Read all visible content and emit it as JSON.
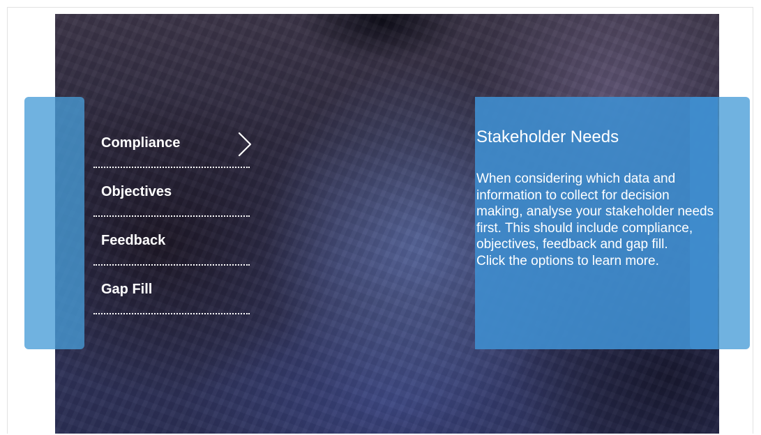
{
  "menu": {
    "items": [
      {
        "label": "Compliance",
        "selected": true
      },
      {
        "label": "Objectives",
        "selected": false
      },
      {
        "label": "Feedback",
        "selected": false
      },
      {
        "label": "Gap Fill",
        "selected": false
      }
    ]
  },
  "panel": {
    "title": "Stakeholder Needs",
    "body": "When considering which data and information to collect for decision making, analyse your stakeholder needs first. This should include compliance, objectives, feedback and gap fill.\nClick the options to learn more."
  },
  "colors": {
    "tab_blue": "#489cd7",
    "panel_blue": "#3f8ccd",
    "text": "#ffffff"
  },
  "icons": {
    "selected_indicator": "chevron-right-icon"
  }
}
